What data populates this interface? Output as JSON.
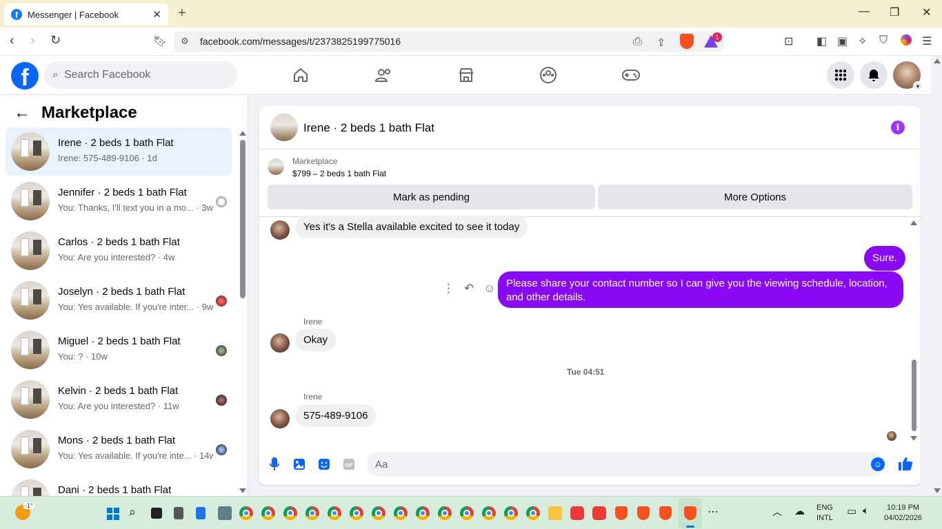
{
  "browser": {
    "tab_title": "Messenger | Facebook",
    "new_tab": "+",
    "url": "facebook.com/messages/t/2373825199775016",
    "rewards_badge": "1"
  },
  "header": {
    "search_placeholder": "Search Facebook"
  },
  "left": {
    "title": "Marketplace",
    "conversations": [
      {
        "name": "Irene · 2 beds 1 bath Flat",
        "sub": "Irene: 575-489-9106 · 1d",
        "active": true
      },
      {
        "name": "Jennifer · 2 beds 1 bath Flat",
        "sub": "You: Thanks, I'll text you in a mo... · 3w"
      },
      {
        "name": "Carlos · 2 beds 1 bath Flat",
        "sub": "You: Are you interested? · 4w"
      },
      {
        "name": "Joselyn · 2 beds 1 bath Flat",
        "sub": "You: Yes available. If you're inter... · 9w"
      },
      {
        "name": "Miguel · 2 beds 1 bath Flat",
        "sub": "You: ? · 10w"
      },
      {
        "name": "Kelvin · 2 beds 1 bath Flat",
        "sub": "You: Are you interested? · 11w"
      },
      {
        "name": "Mons · 2 beds 1 bath Flat",
        "sub": "You: Yes available. If you're inte... · 14w"
      },
      {
        "name": "Dani · 2 beds 1 bath Flat",
        "sub": ""
      }
    ]
  },
  "chat": {
    "title": "Irene · 2 beds 1 bath Flat",
    "marketplace_label": "Marketplace",
    "listing": "$799 – 2 beds 1 bath Flat",
    "mark_pending": "Mark as pending",
    "more_options": "More Options",
    "messages": {
      "m1": "Yes it's a Stella available excited to see it today",
      "m2": "Sure.",
      "m3": "Please share your contact number so I can give you the viewing schedule, location, and other details.",
      "sender1": "Irene",
      "m4": "Okay",
      "timestamp": "Tue 04:51",
      "sender2": "Irene",
      "m5": "575-489-9106"
    },
    "composer_placeholder": "Aa"
  },
  "taskbar": {
    "weather": "-1°",
    "lang1": "ENG",
    "lang2": "INTL",
    "time": "10:19 PM",
    "date": "04/02/2026"
  },
  "colors": {
    "fb_blue": "#0866ff",
    "outgoing_bubble": "#8a09f5",
    "active_row": "#e7f3ff"
  }
}
